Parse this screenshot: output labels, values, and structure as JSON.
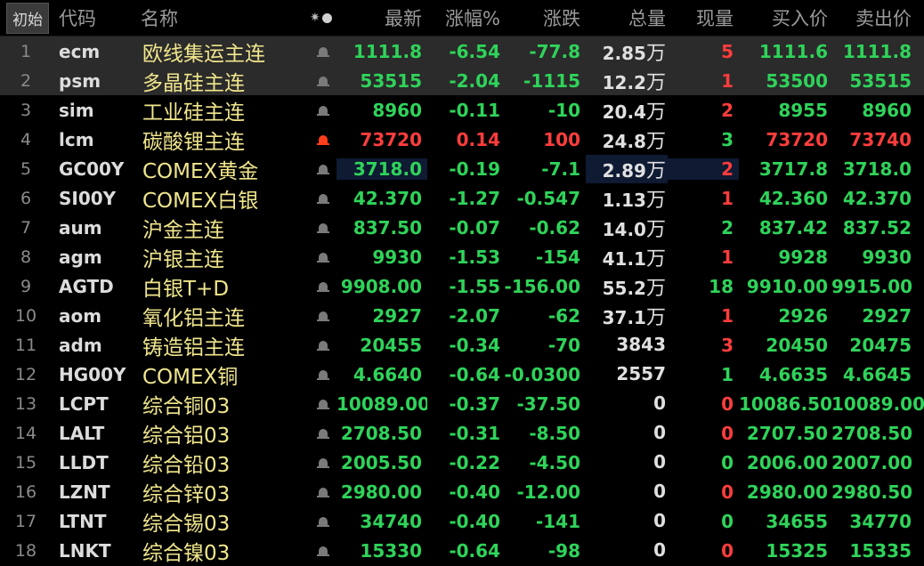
{
  "header": {
    "sort_button": "初始",
    "code": "代码",
    "name": "名称",
    "gear_glyph": "✷",
    "last": "最新",
    "pct": "涨幅%",
    "chg": "涨跌",
    "vol": "总量",
    "cur": "现量",
    "bid": "买入价",
    "ask": "卖出价"
  },
  "colors": {
    "up": "#ff3d3d",
    "down": "#2fd35a",
    "name": "#f0e68c",
    "selected_row_bg": "#2b2b2b",
    "highlight_cell_bg": "#0f1a33"
  },
  "rows": [
    {
      "idx": "1",
      "code": "ecm",
      "name": "欧线集运主连",
      "bell": false,
      "last": "1111.8",
      "pct": "-6.54",
      "chg": "-77.8",
      "vol": "2.85",
      "unit": "万",
      "cur": "5",
      "cur_color": "red",
      "bid": "1111.6",
      "ask": "1111.8",
      "dir": "green",
      "bid_dir": "green",
      "ask_dir": "green",
      "selected": true
    },
    {
      "idx": "2",
      "code": "psm",
      "name": "多晶硅主连",
      "bell": false,
      "last": "53515",
      "pct": "-2.04",
      "chg": "-1115",
      "vol": "12.2",
      "unit": "万",
      "cur": "1",
      "cur_color": "red",
      "bid": "53500",
      "ask": "53515",
      "dir": "green",
      "bid_dir": "green",
      "ask_dir": "green",
      "selected": true
    },
    {
      "idx": "3",
      "code": "sim",
      "name": "工业硅主连",
      "bell": false,
      "last": "8960",
      "pct": "-0.11",
      "chg": "-10",
      "vol": "20.4",
      "unit": "万",
      "cur": "2",
      "cur_color": "red",
      "bid": "8955",
      "ask": "8960",
      "dir": "green",
      "bid_dir": "green",
      "ask_dir": "green"
    },
    {
      "idx": "4",
      "code": "lcm",
      "name": "碳酸锂主连",
      "bell": true,
      "last": "73720",
      "pct": "0.14",
      "chg": "100",
      "vol": "24.8",
      "unit": "万",
      "cur": "3",
      "cur_color": "green",
      "bid": "73720",
      "ask": "73740",
      "dir": "red",
      "bid_dir": "red",
      "ask_dir": "red"
    },
    {
      "idx": "5",
      "code": "GC00Y",
      "name": "COMEX黄金",
      "bell": false,
      "last": "3718.0",
      "pct": "-0.19",
      "chg": "-7.1",
      "vol": "2.89",
      "unit": "万",
      "cur": "2",
      "cur_color": "red",
      "bid": "3717.8",
      "ask": "3718.0",
      "dir": "green",
      "bid_dir": "green",
      "ask_dir": "green",
      "hl": true
    },
    {
      "idx": "6",
      "code": "SI00Y",
      "name": "COMEX白银",
      "bell": false,
      "last": "42.370",
      "pct": "-1.27",
      "chg": "-0.547",
      "vol": "1.13",
      "unit": "万",
      "cur": "1",
      "cur_color": "red",
      "bid": "42.360",
      "ask": "42.370",
      "dir": "green",
      "bid_dir": "green",
      "ask_dir": "green"
    },
    {
      "idx": "7",
      "code": "aum",
      "name": "沪金主连",
      "bell": false,
      "last": "837.50",
      "pct": "-0.07",
      "chg": "-0.62",
      "vol": "14.0",
      "unit": "万",
      "cur": "2",
      "cur_color": "green",
      "bid": "837.42",
      "ask": "837.52",
      "dir": "green",
      "bid_dir": "green",
      "ask_dir": "green"
    },
    {
      "idx": "8",
      "code": "agm",
      "name": "沪银主连",
      "bell": false,
      "last": "9930",
      "pct": "-1.53",
      "chg": "-154",
      "vol": "41.1",
      "unit": "万",
      "cur": "1",
      "cur_color": "red",
      "bid": "9928",
      "ask": "9930",
      "dir": "green",
      "bid_dir": "green",
      "ask_dir": "green"
    },
    {
      "idx": "9",
      "code": "AGTD",
      "name": "白银T+D",
      "bell": false,
      "last": "9908.00",
      "pct": "-1.55",
      "chg": "-156.00",
      "vol": "55.2",
      "unit": "万",
      "cur": "18",
      "cur_color": "green",
      "bid": "9910.00",
      "ask": "9915.00",
      "dir": "green",
      "bid_dir": "green",
      "ask_dir": "green"
    },
    {
      "idx": "10",
      "code": "aom",
      "name": "氧化铝主连",
      "bell": false,
      "last": "2927",
      "pct": "-2.07",
      "chg": "-62",
      "vol": "37.1",
      "unit": "万",
      "cur": "1",
      "cur_color": "red",
      "bid": "2926",
      "ask": "2927",
      "dir": "green",
      "bid_dir": "green",
      "ask_dir": "green"
    },
    {
      "idx": "11",
      "code": "adm",
      "name": "铸造铝主连",
      "bell": false,
      "last": "20455",
      "pct": "-0.34",
      "chg": "-70",
      "vol": "3843",
      "unit": "",
      "cur": "3",
      "cur_color": "red",
      "bid": "20450",
      "ask": "20475",
      "dir": "green",
      "bid_dir": "green",
      "ask_dir": "green"
    },
    {
      "idx": "12",
      "code": "HG00Y",
      "name": "COMEX铜",
      "bell": false,
      "last": "4.6640",
      "pct": "-0.64",
      "chg": "-0.0300",
      "vol": "2557",
      "unit": "",
      "cur": "1",
      "cur_color": "green",
      "bid": "4.6635",
      "ask": "4.6645",
      "dir": "green",
      "bid_dir": "green",
      "ask_dir": "green"
    },
    {
      "idx": "13",
      "code": "LCPT",
      "name": "综合铜03",
      "bell": false,
      "last": "10089.00",
      "pct": "-0.37",
      "chg": "-37.50",
      "vol": "0",
      "unit": "",
      "cur": "0",
      "cur_color": "red",
      "bid": "10086.50",
      "ask": "10089.00",
      "dir": "green",
      "bid_dir": "green",
      "ask_dir": "green"
    },
    {
      "idx": "14",
      "code": "LALT",
      "name": "综合铝03",
      "bell": false,
      "last": "2708.50",
      "pct": "-0.31",
      "chg": "-8.50",
      "vol": "0",
      "unit": "",
      "cur": "0",
      "cur_color": "red",
      "bid": "2707.50",
      "ask": "2708.50",
      "dir": "green",
      "bid_dir": "green",
      "ask_dir": "green"
    },
    {
      "idx": "15",
      "code": "LLDT",
      "name": "综合铅03",
      "bell": false,
      "last": "2005.50",
      "pct": "-0.22",
      "chg": "-4.50",
      "vol": "0",
      "unit": "",
      "cur": "0",
      "cur_color": "green",
      "bid": "2006.00",
      "ask": "2007.00",
      "dir": "green",
      "bid_dir": "green",
      "ask_dir": "green"
    },
    {
      "idx": "16",
      "code": "LZNT",
      "name": "综合锌03",
      "bell": false,
      "last": "2980.00",
      "pct": "-0.40",
      "chg": "-12.00",
      "vol": "0",
      "unit": "",
      "cur": "0",
      "cur_color": "red",
      "bid": "2980.00",
      "ask": "2980.50",
      "dir": "green",
      "bid_dir": "green",
      "ask_dir": "green"
    },
    {
      "idx": "17",
      "code": "LTNT",
      "name": "综合锡03",
      "bell": false,
      "last": "34740",
      "pct": "-0.40",
      "chg": "-141",
      "vol": "0",
      "unit": "",
      "cur": "0",
      "cur_color": "green",
      "bid": "34655",
      "ask": "34770",
      "dir": "green",
      "bid_dir": "green",
      "ask_dir": "green"
    },
    {
      "idx": "18",
      "code": "LNKT",
      "name": "综合镍03",
      "bell": false,
      "last": "15330",
      "pct": "-0.64",
      "chg": "-98",
      "vol": "0",
      "unit": "",
      "cur": "0",
      "cur_color": "red",
      "bid": "15325",
      "ask": "15335",
      "dir": "green",
      "bid_dir": "green",
      "ask_dir": "green"
    }
  ]
}
